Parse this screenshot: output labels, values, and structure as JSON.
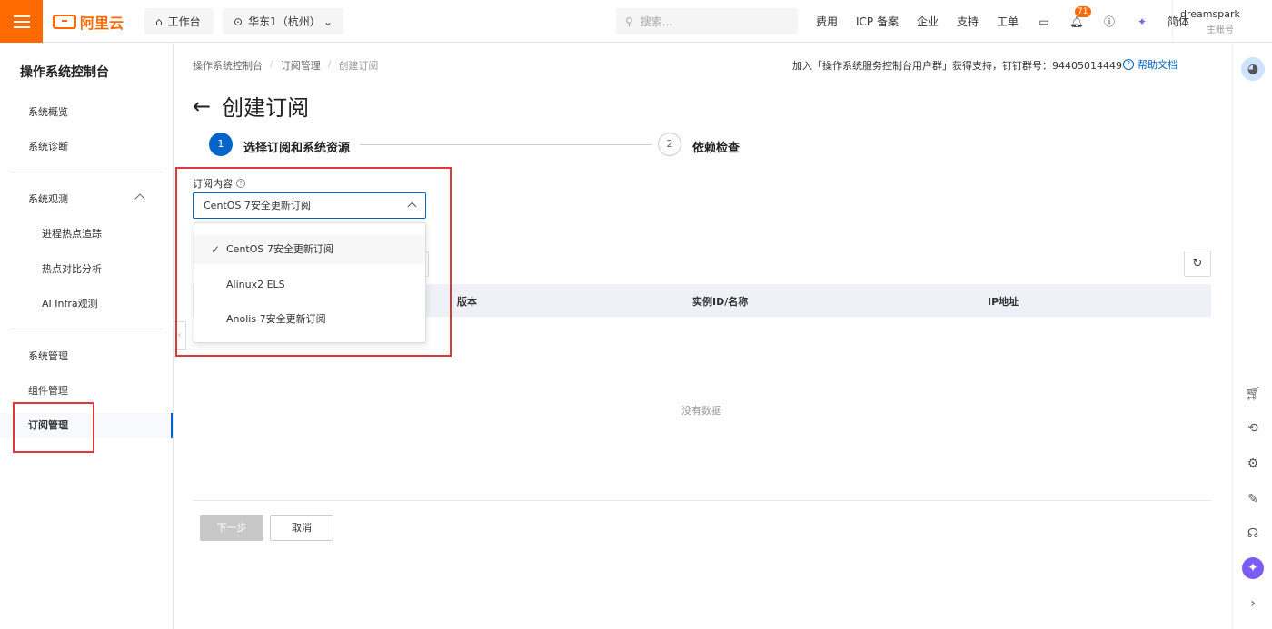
{
  "topbar": {
    "brand": "阿里云",
    "workbench": "工作台",
    "region": "华东1（杭州）",
    "search_placeholder": "搜索...",
    "nav": [
      "费用",
      "ICP 备案",
      "企业",
      "支持",
      "工单"
    ],
    "notification_count": "71",
    "language": "简体",
    "username": "dreamspark",
    "user_role": "主账号",
    "accent_color": "#ff6a00"
  },
  "sidebar": {
    "title": "操作系统控制台",
    "items": {
      "overview": "系统概览",
      "diagnosis": "系统诊断",
      "observe": "系统观测",
      "process_hotspot": "进程热点追踪",
      "hotspot_compare": "热点对比分析",
      "ai_infra": "AI Infra观测",
      "manage": "系统管理",
      "components": "组件管理",
      "subscription": "订阅管理"
    }
  },
  "main": {
    "breadcrumb": [
      "操作系统控制台",
      "订阅管理",
      "创建订阅"
    ],
    "notice": "加入「操作系统服务控制台用户群」获得支持，钉钉群号：94405014449",
    "help_link": "帮助文档",
    "page_title": "创建订阅",
    "steps": [
      {
        "number": "1",
        "label": "选择订阅和系统资源"
      },
      {
        "number": "2",
        "label": "依赖检查"
      }
    ],
    "field_label": "订阅内容",
    "select_value": "CentOS 7安全更新订阅",
    "dropdown_options": [
      "CentOS 7安全更新订阅",
      "Alinux2 ELS",
      "Anolis 7安全更新订阅"
    ],
    "table_columns": [
      "版本",
      "实例ID/名称",
      "IP地址"
    ],
    "empty_text": "没有数据",
    "next_button": "下一步",
    "cancel_button": "取消"
  }
}
